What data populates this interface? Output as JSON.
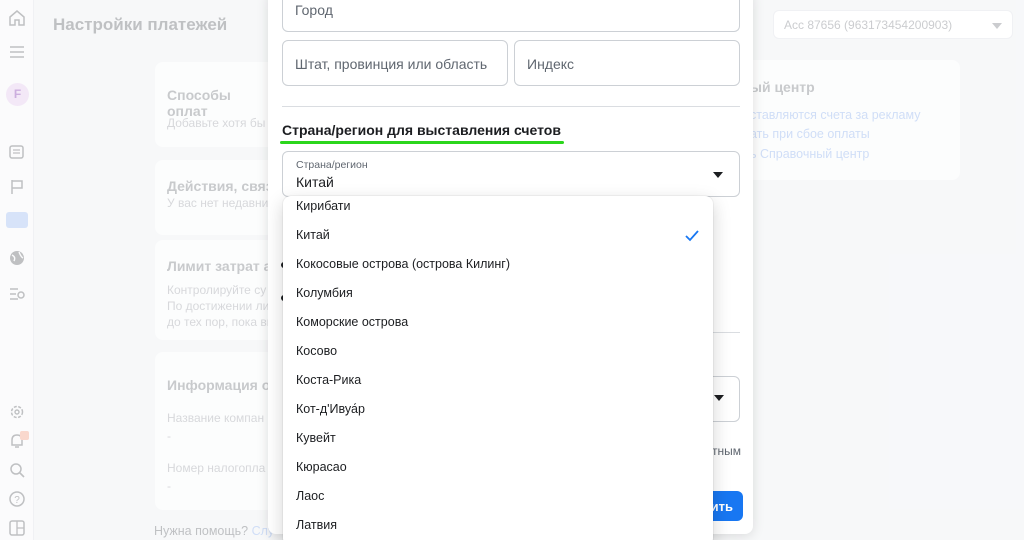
{
  "page": {
    "title": "Настройки платежей",
    "account": "Acc 87656 (963173454200903)",
    "help_text": "Нужна помощь?",
    "help_link": "Слу"
  },
  "rail": {
    "avatar_letter": "F"
  },
  "cards": [
    {
      "title": "Способы оплат",
      "text": "Добавьте хотя бы"
    },
    {
      "title": "Действия, связ",
      "text": "У вас нет недавни"
    },
    {
      "title": "Лимит затрат а",
      "lines": [
        "Контролируйте су",
        "По достижении ли",
        "до тех пор, пока вь"
      ]
    },
    {
      "title": "Информация о",
      "lines": [
        "Название компан",
        "-",
        "Номер налогопла",
        "-"
      ]
    }
  ],
  "help_center": {
    "title": "ый центр",
    "links": [
      "ставляются счета за рекламу",
      "ать при сбое оплаты",
      "ь Справочный центр"
    ]
  },
  "modal": {
    "city_placeholder": "Город",
    "state_placeholder": "Штат, провинция или область",
    "zip_placeholder": "Индекс",
    "section_title": "Страна/регион для выставления счетов",
    "country_label": "Страна/регион",
    "country_value": "Китай",
    "partial_text": "тным",
    "partial_button": "ить"
  },
  "dropdown": {
    "selected": "Китай",
    "options": [
      "Кирибати",
      "Китай",
      "Кокосовые острова (острова Килинг)",
      "Колумбия",
      "Коморские острова",
      "Косово",
      "Коста-Рика",
      "Кот-д'Ивуа́р",
      "Кувейт",
      "Кюрасао",
      "Лаос",
      "Латвия"
    ]
  },
  "colors": {
    "accent": "#1877f2",
    "highlight_underline": "#2bd61c"
  }
}
